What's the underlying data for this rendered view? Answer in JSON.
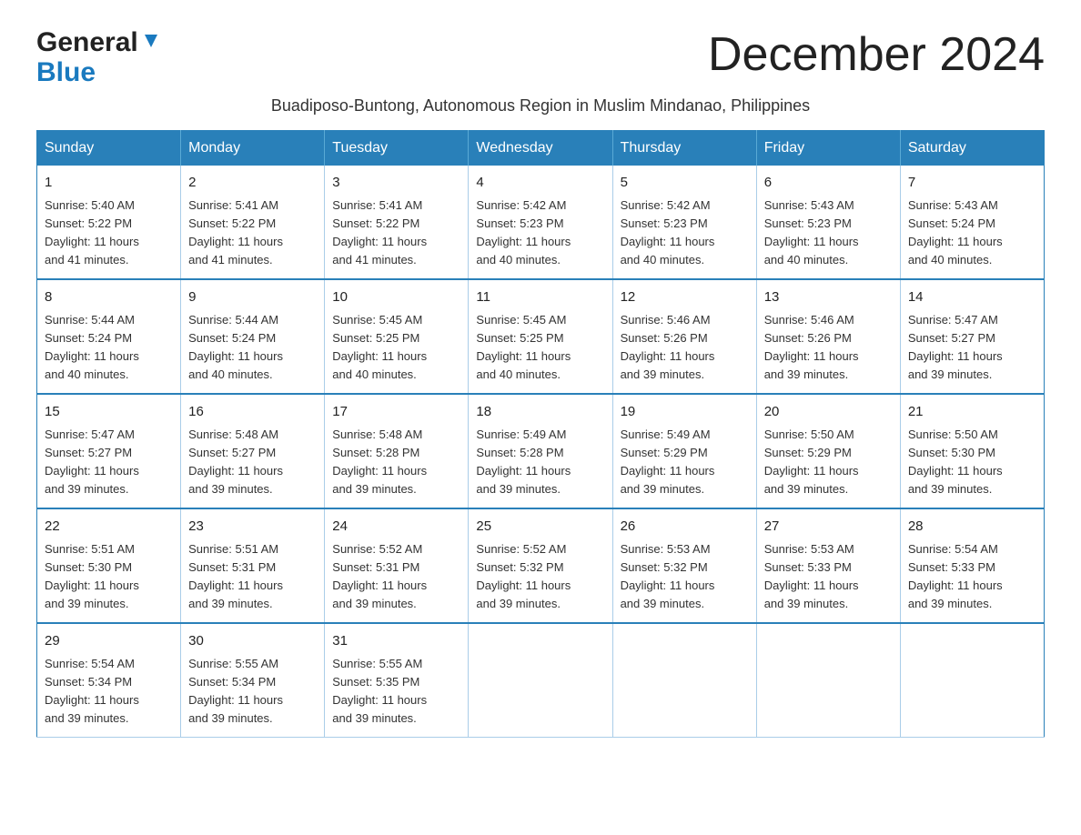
{
  "header": {
    "logo_line1": "General",
    "logo_line2": "Blue",
    "title": "December 2024",
    "subtitle": "Buadiposo-Buntong, Autonomous Region in Muslim Mindanao, Philippines"
  },
  "calendar": {
    "days_of_week": [
      "Sunday",
      "Monday",
      "Tuesday",
      "Wednesday",
      "Thursday",
      "Friday",
      "Saturday"
    ],
    "weeks": [
      [
        {
          "day": "1",
          "sunrise": "5:40 AM",
          "sunset": "5:22 PM",
          "daylight": "11 hours and 41 minutes."
        },
        {
          "day": "2",
          "sunrise": "5:41 AM",
          "sunset": "5:22 PM",
          "daylight": "11 hours and 41 minutes."
        },
        {
          "day": "3",
          "sunrise": "5:41 AM",
          "sunset": "5:22 PM",
          "daylight": "11 hours and 41 minutes."
        },
        {
          "day": "4",
          "sunrise": "5:42 AM",
          "sunset": "5:23 PM",
          "daylight": "11 hours and 40 minutes."
        },
        {
          "day": "5",
          "sunrise": "5:42 AM",
          "sunset": "5:23 PM",
          "daylight": "11 hours and 40 minutes."
        },
        {
          "day": "6",
          "sunrise": "5:43 AM",
          "sunset": "5:23 PM",
          "daylight": "11 hours and 40 minutes."
        },
        {
          "day": "7",
          "sunrise": "5:43 AM",
          "sunset": "5:24 PM",
          "daylight": "11 hours and 40 minutes."
        }
      ],
      [
        {
          "day": "8",
          "sunrise": "5:44 AM",
          "sunset": "5:24 PM",
          "daylight": "11 hours and 40 minutes."
        },
        {
          "day": "9",
          "sunrise": "5:44 AM",
          "sunset": "5:24 PM",
          "daylight": "11 hours and 40 minutes."
        },
        {
          "day": "10",
          "sunrise": "5:45 AM",
          "sunset": "5:25 PM",
          "daylight": "11 hours and 40 minutes."
        },
        {
          "day": "11",
          "sunrise": "5:45 AM",
          "sunset": "5:25 PM",
          "daylight": "11 hours and 40 minutes."
        },
        {
          "day": "12",
          "sunrise": "5:46 AM",
          "sunset": "5:26 PM",
          "daylight": "11 hours and 39 minutes."
        },
        {
          "day": "13",
          "sunrise": "5:46 AM",
          "sunset": "5:26 PM",
          "daylight": "11 hours and 39 minutes."
        },
        {
          "day": "14",
          "sunrise": "5:47 AM",
          "sunset": "5:27 PM",
          "daylight": "11 hours and 39 minutes."
        }
      ],
      [
        {
          "day": "15",
          "sunrise": "5:47 AM",
          "sunset": "5:27 PM",
          "daylight": "11 hours and 39 minutes."
        },
        {
          "day": "16",
          "sunrise": "5:48 AM",
          "sunset": "5:27 PM",
          "daylight": "11 hours and 39 minutes."
        },
        {
          "day": "17",
          "sunrise": "5:48 AM",
          "sunset": "5:28 PM",
          "daylight": "11 hours and 39 minutes."
        },
        {
          "day": "18",
          "sunrise": "5:49 AM",
          "sunset": "5:28 PM",
          "daylight": "11 hours and 39 minutes."
        },
        {
          "day": "19",
          "sunrise": "5:49 AM",
          "sunset": "5:29 PM",
          "daylight": "11 hours and 39 minutes."
        },
        {
          "day": "20",
          "sunrise": "5:50 AM",
          "sunset": "5:29 PM",
          "daylight": "11 hours and 39 minutes."
        },
        {
          "day": "21",
          "sunrise": "5:50 AM",
          "sunset": "5:30 PM",
          "daylight": "11 hours and 39 minutes."
        }
      ],
      [
        {
          "day": "22",
          "sunrise": "5:51 AM",
          "sunset": "5:30 PM",
          "daylight": "11 hours and 39 minutes."
        },
        {
          "day": "23",
          "sunrise": "5:51 AM",
          "sunset": "5:31 PM",
          "daylight": "11 hours and 39 minutes."
        },
        {
          "day": "24",
          "sunrise": "5:52 AM",
          "sunset": "5:31 PM",
          "daylight": "11 hours and 39 minutes."
        },
        {
          "day": "25",
          "sunrise": "5:52 AM",
          "sunset": "5:32 PM",
          "daylight": "11 hours and 39 minutes."
        },
        {
          "day": "26",
          "sunrise": "5:53 AM",
          "sunset": "5:32 PM",
          "daylight": "11 hours and 39 minutes."
        },
        {
          "day": "27",
          "sunrise": "5:53 AM",
          "sunset": "5:33 PM",
          "daylight": "11 hours and 39 minutes."
        },
        {
          "day": "28",
          "sunrise": "5:54 AM",
          "sunset": "5:33 PM",
          "daylight": "11 hours and 39 minutes."
        }
      ],
      [
        {
          "day": "29",
          "sunrise": "5:54 AM",
          "sunset": "5:34 PM",
          "daylight": "11 hours and 39 minutes."
        },
        {
          "day": "30",
          "sunrise": "5:55 AM",
          "sunset": "5:34 PM",
          "daylight": "11 hours and 39 minutes."
        },
        {
          "day": "31",
          "sunrise": "5:55 AM",
          "sunset": "5:35 PM",
          "daylight": "11 hours and 39 minutes."
        },
        null,
        null,
        null,
        null
      ]
    ],
    "labels": {
      "sunrise": "Sunrise: ",
      "sunset": "Sunset: ",
      "daylight": "Daylight: "
    }
  }
}
